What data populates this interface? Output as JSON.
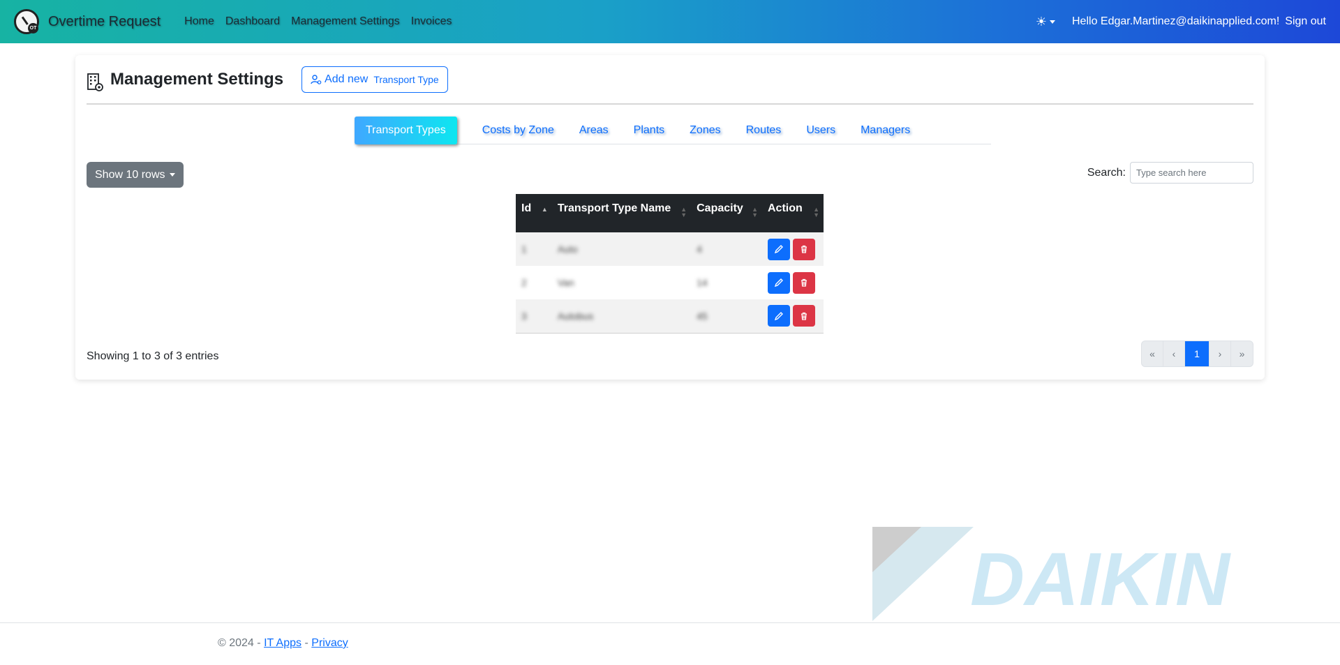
{
  "navbar": {
    "brand": "Overtime Request",
    "links": [
      "Home",
      "Dashboard",
      "Management Settings",
      "Invoices"
    ],
    "greeting": "Hello Edgar.Martinez@daikinapplied.com!",
    "signout": "Sign out",
    "brand_colors": [
      "#17b3a3",
      "#1d48d8"
    ]
  },
  "page": {
    "title": "Management Settings",
    "add_button": {
      "label": "Add new",
      "entity": "Transport Type"
    }
  },
  "tabs": [
    {
      "label": "Transport Types",
      "active": true
    },
    {
      "label": "Costs by Zone"
    },
    {
      "label": "Areas"
    },
    {
      "label": "Plants"
    },
    {
      "label": "Zones"
    },
    {
      "label": "Routes"
    },
    {
      "label": "Users"
    },
    {
      "label": "Managers"
    }
  ],
  "controls": {
    "rows_label": "Show 10 rows",
    "search_label": "Search:",
    "search_placeholder": "Type search here"
  },
  "table": {
    "columns": [
      "Id",
      "Transport Type Name",
      "Capacity",
      "Action"
    ],
    "rows": [
      {
        "id": "1",
        "name": "Auto",
        "capacity": "4"
      },
      {
        "id": "2",
        "name": "Van",
        "capacity": "14"
      },
      {
        "id": "3",
        "name": "Autobus",
        "capacity": "45"
      }
    ]
  },
  "info": "Showing 1 to 3 of 3 entries",
  "pagination": [
    "«",
    "‹",
    "1",
    "›",
    "»"
  ],
  "pagination_active": "1",
  "watermark": "DAIKIN",
  "footer": {
    "copyright": "© 2024 -",
    "link1": "IT Apps",
    "sep": "-",
    "link2": "Privacy"
  }
}
